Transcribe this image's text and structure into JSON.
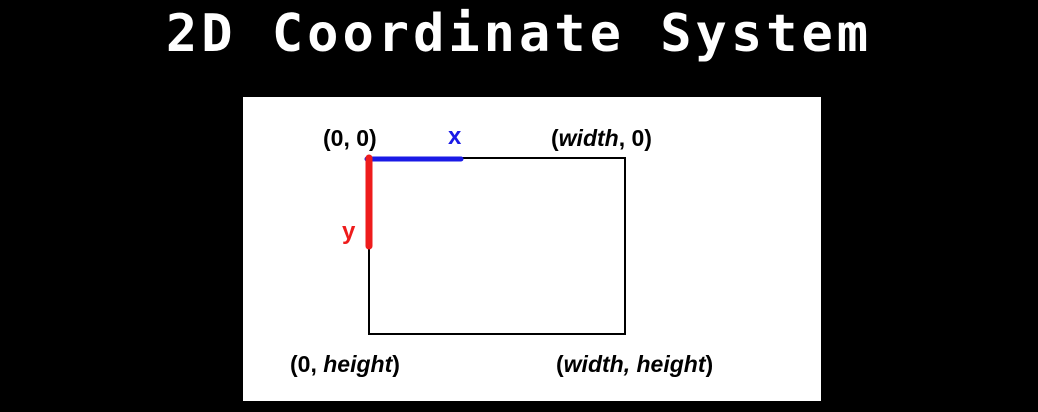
{
  "title": "2D Coordinate System",
  "diagram": {
    "labels": {
      "top_left": "(0, 0)",
      "top_right": {
        "open": "(",
        "italic": "width",
        "close": ", 0)"
      },
      "bottom_left": {
        "open": "(0, ",
        "italic": "height",
        "close": ")"
      },
      "bottom_right": {
        "open": "(",
        "italic": "width, height",
        "close": ")"
      }
    },
    "x_axis_label": "x",
    "y_axis_label": "y",
    "colors": {
      "x_axis": "#1a1ae6",
      "y_axis": "#ee1c1c",
      "background": "#000000",
      "panel": "#ffffff",
      "title": "#ffffff"
    }
  }
}
